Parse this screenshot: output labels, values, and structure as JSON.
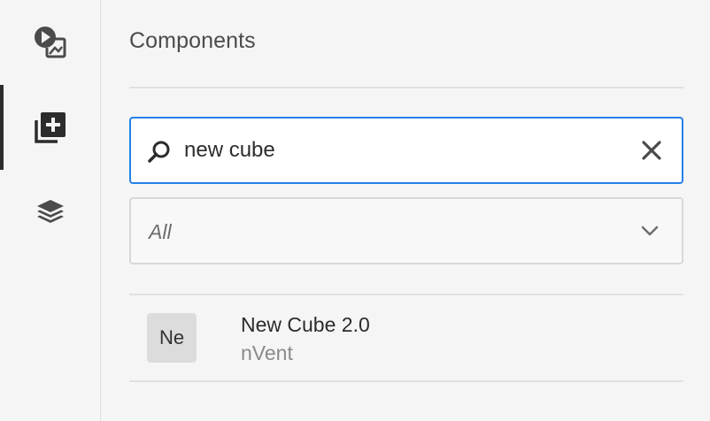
{
  "rail": {
    "items": [
      {
        "icon": "asset-media-icon",
        "active": false
      },
      {
        "icon": "add-component-icon",
        "active": true
      },
      {
        "icon": "layers-icon",
        "active": false
      }
    ]
  },
  "panel": {
    "title": "Components"
  },
  "search": {
    "value": "new cube",
    "placeholder": "",
    "clear_icon": "close-icon"
  },
  "filter": {
    "selected": "All",
    "icon": "chevron-down-icon"
  },
  "results": [
    {
      "thumb": "Ne",
      "title": "New Cube 2.0",
      "group": "nVent"
    }
  ],
  "colors": {
    "accent": "#2680eb",
    "text": "#2c2c2c",
    "muted": "#8a8a8a",
    "background": "#f5f5f5"
  }
}
